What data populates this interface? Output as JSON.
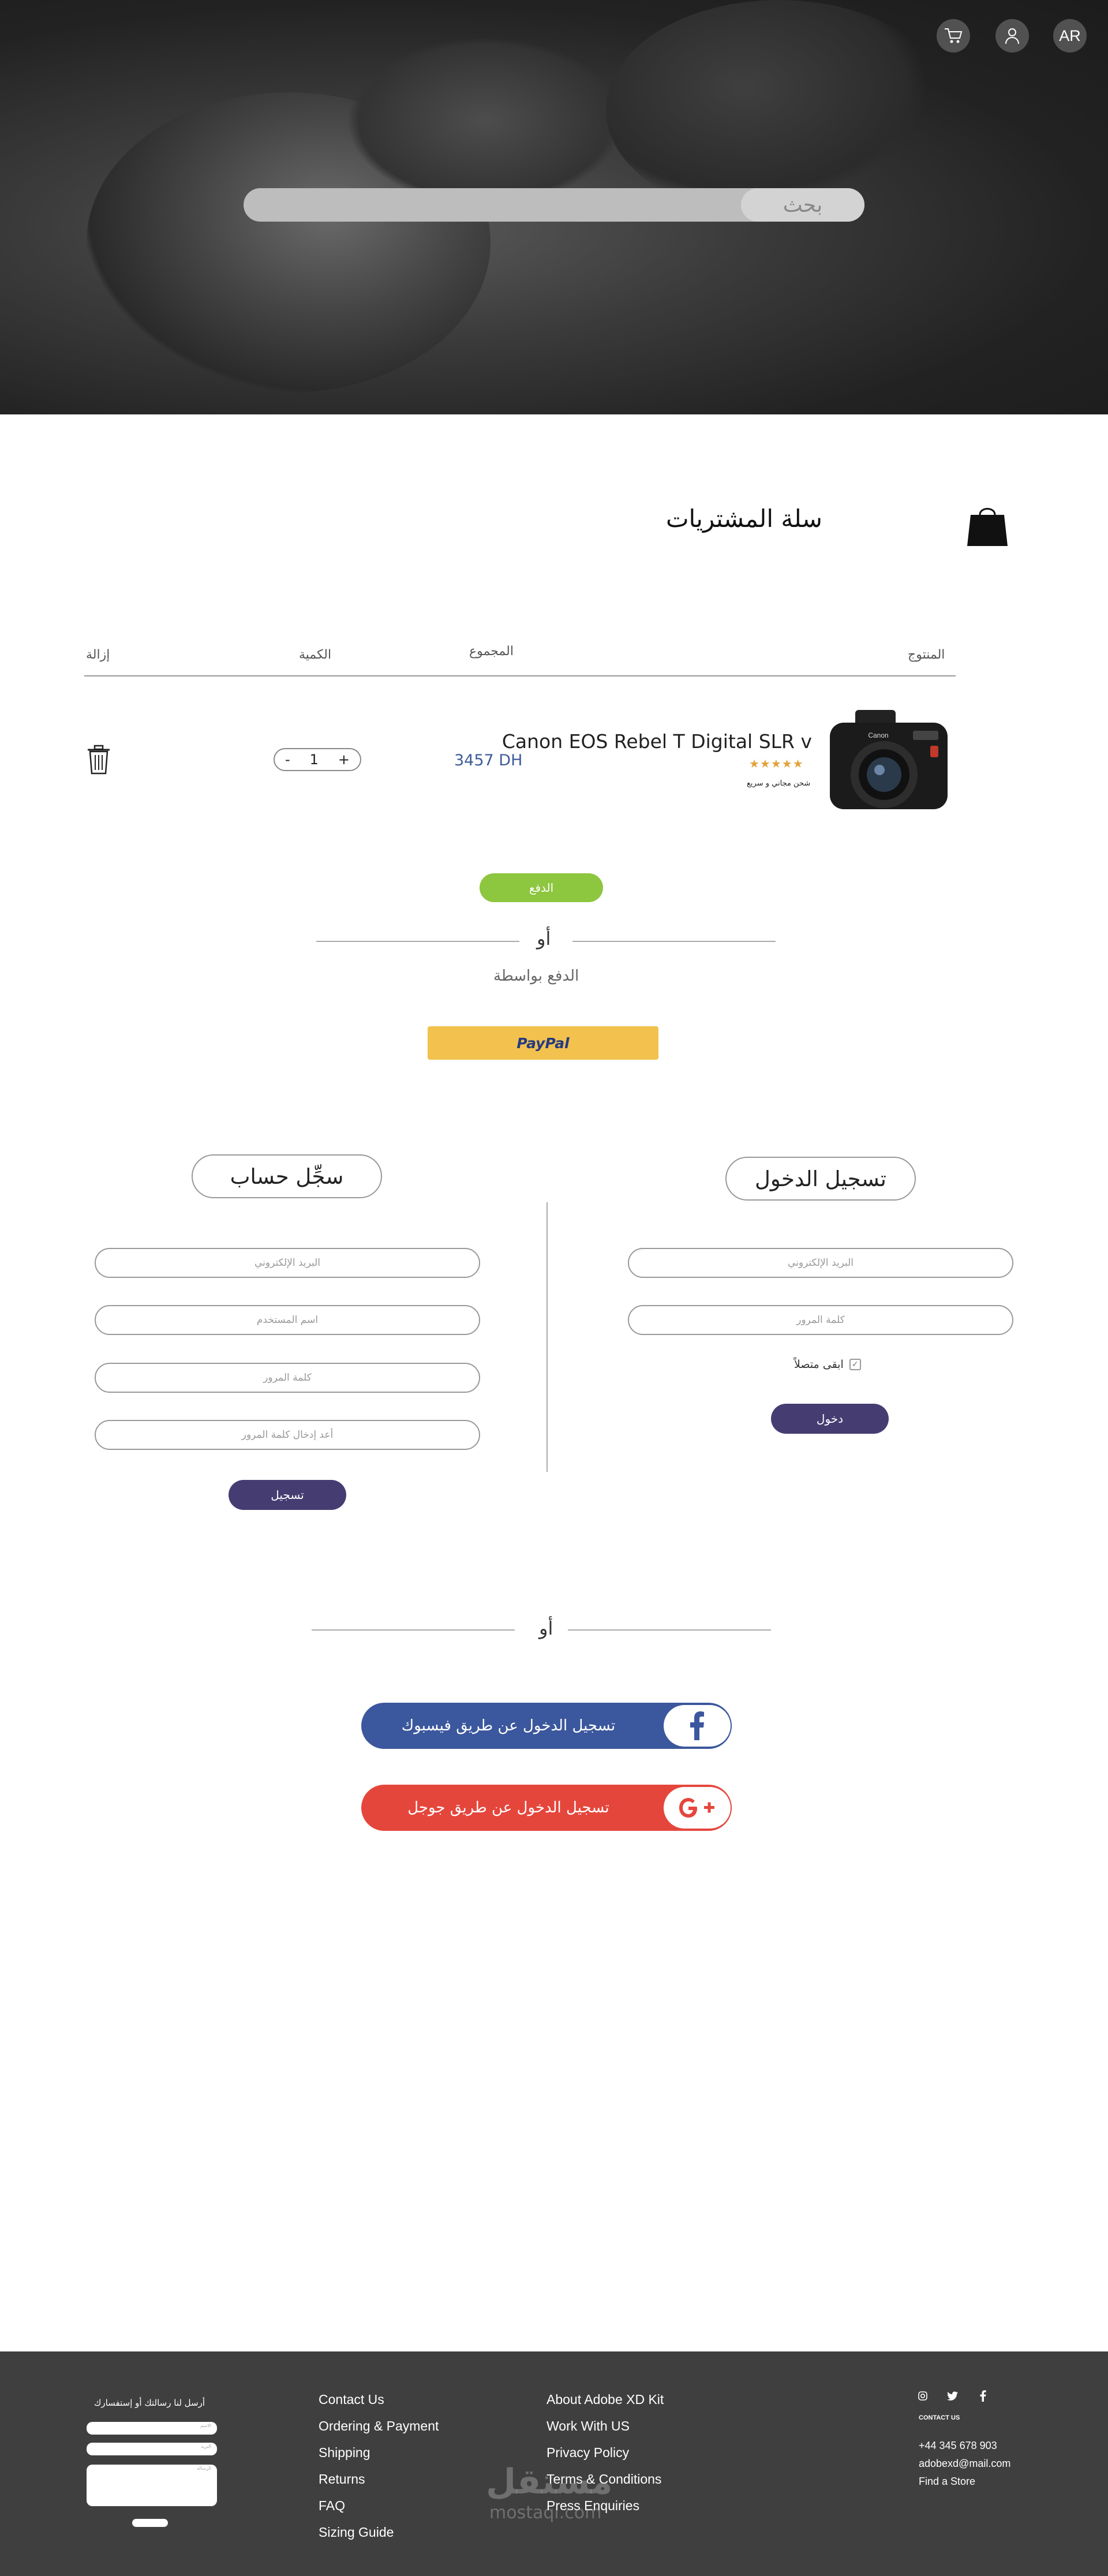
{
  "hero": {
    "lang_label": "AR",
    "search_label": "بحث",
    "icons": [
      "cart-icon",
      "user-icon"
    ]
  },
  "cart": {
    "title": "سلة المشتريات",
    "headers": {
      "product": "المنتوج",
      "total": "المجموع",
      "quantity": "الكمية",
      "remove": "إزالة"
    },
    "item": {
      "name": "Canon EOS Rebel T Digital SLR v",
      "stars": "★★★★★",
      "rating": 5,
      "shipping": "شحن مجاني و سريع",
      "total": "3457 DH",
      "qty": "1",
      "minus": "-",
      "plus": "+"
    },
    "pay_label": "الدفع",
    "or": "أو",
    "pay_with": "الدفع بواسطة",
    "paypal": "PayPal"
  },
  "login": {
    "title": "تسجيل الدخول",
    "email_ph": "البريد الإلكتروني",
    "password_ph": "كلمة المرور",
    "remember": "ابقى متصلاً",
    "submit": "دخول"
  },
  "register": {
    "title": "سجِّل حساب",
    "email_ph": "البريد الإلكتروني",
    "username_ph": "اسم المستخدم",
    "password_ph": "كلمة المرور",
    "confirm_ph": "أعد إدخال كلمة المرور",
    "submit": "تسجيل"
  },
  "social": {
    "or": "أو",
    "facebook": "تسجيل الدخول عن طريق فيسبوك",
    "google": "تسجيل الدخول عن طريق جوجل",
    "facebook_color": "#3b579d",
    "google_color": "#e5463c"
  },
  "footer": {
    "form_title": "أرسل لنا رسالتك أو إستفسارك",
    "name_ph": "الاسم",
    "email_ph": "البريد",
    "message_ph": "الرسالة",
    "col1": [
      "Contact Us",
      "Ordering & Payment",
      "Shipping",
      "Returns",
      "FAQ",
      "Sizing Guide"
    ],
    "col2": [
      "About Adobe XD Kit",
      "Work With US",
      "Privacy Policy",
      "Terms & Conditions",
      "Press Enquiries"
    ],
    "contact_heading": "CONTACT US",
    "phone": "+44 345 678 903",
    "email": "adobexd@mail.com",
    "store": "Find a Store",
    "watermark": "مستقل",
    "watermark_sub": "mostaql.com"
  }
}
